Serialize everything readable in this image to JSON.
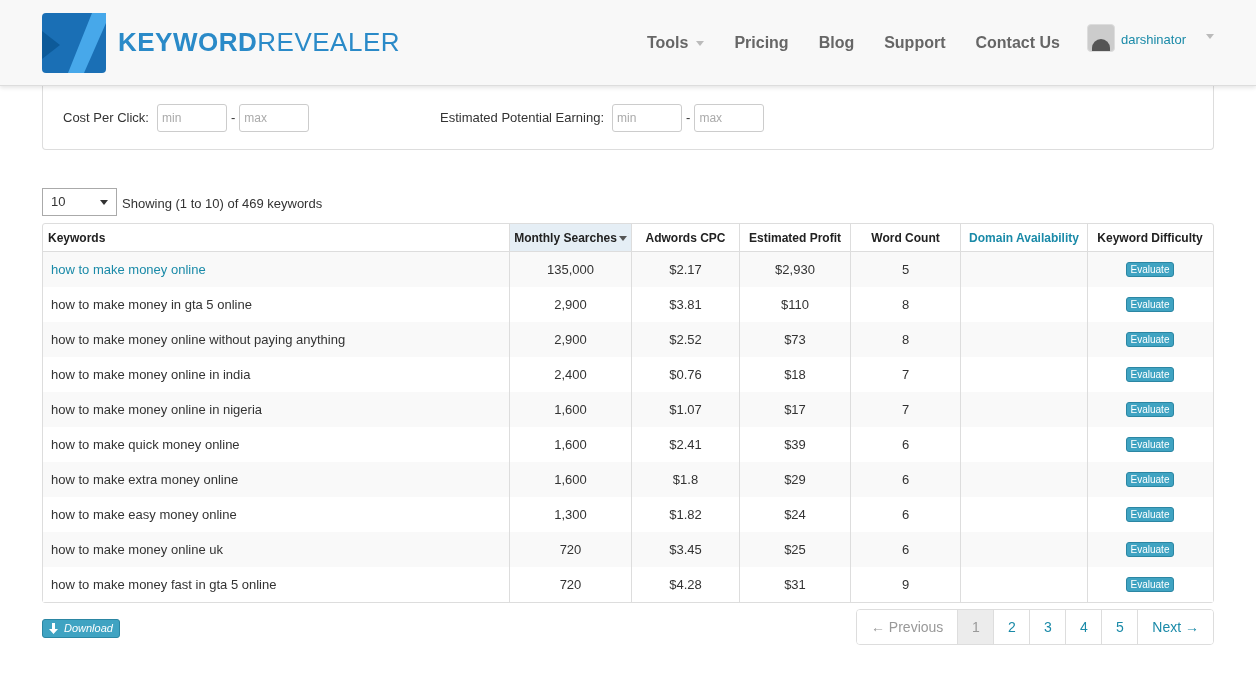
{
  "logo": {
    "text": "**KEYWORD**REVEALER"
  },
  "nav": [
    {
      "label": "Tools",
      "dropdown": true
    },
    {
      "label": "Pricing",
      "dropdown": false
    },
    {
      "label": "Blog",
      "dropdown": false
    },
    {
      "label": "Support",
      "dropdown": false
    },
    {
      "label": "Contact Us",
      "dropdown": false
    }
  ],
  "user": {
    "name": "darshinator"
  },
  "filters": [
    {
      "label": "Cost Per Click:",
      "min_placeholder": "min",
      "separator": "-",
      "max_placeholder": "max"
    },
    {
      "label": "Estimated Potential Earning:",
      "min_placeholder": "min",
      "separator": "-",
      "max_placeholder": "max"
    }
  ],
  "page_size": {
    "value": "10",
    "summary": "Showing (1 to 10) of 469 keywords"
  },
  "table": {
    "columns": [
      {
        "label": "Keywords",
        "kind": "plain",
        "selected": false
      },
      {
        "label": "Monthly Searches",
        "kind": "plain",
        "selected": true
      },
      {
        "label": "Adwords CPC",
        "kind": "plain",
        "selected": false
      },
      {
        "label": "Estimated Profit",
        "kind": "plain",
        "selected": false
      },
      {
        "label": "Word Count",
        "kind": "plain",
        "selected": false
      },
      {
        "label": "Domain Availability",
        "kind": "link",
        "selected": false
      },
      {
        "label": "Keyword Difficulty",
        "kind": "plain",
        "selected": false
      }
    ],
    "rows": [
      {
        "keyword": "how to make money online",
        "kind": "link",
        "searches": "135,000",
        "cpc": "$2.17",
        "profit": "$2,930",
        "words": "5",
        "action": "Evaluate"
      },
      {
        "keyword": "how to make money in gta 5 online",
        "kind": "plain",
        "searches": "2,900",
        "cpc": "$3.81",
        "profit": "$110",
        "words": "8",
        "action": "Evaluate"
      },
      {
        "keyword": "how to make money online without paying anything",
        "kind": "plain",
        "searches": "2,900",
        "cpc": "$2.52",
        "profit": "$73",
        "words": "8",
        "action": "Evaluate"
      },
      {
        "keyword": "how to make money online in india",
        "kind": "plain",
        "searches": "2,400",
        "cpc": "$0.76",
        "profit": "$18",
        "words": "7",
        "action": "Evaluate"
      },
      {
        "keyword": "how to make money online in nigeria",
        "kind": "plain",
        "searches": "1,600",
        "cpc": "$1.07",
        "profit": "$17",
        "words": "7",
        "action": "Evaluate"
      },
      {
        "keyword": "how to make quick money online",
        "kind": "plain",
        "searches": "1,600",
        "cpc": "$2.41",
        "profit": "$39",
        "words": "6",
        "action": "Evaluate"
      },
      {
        "keyword": "how to make extra money online",
        "kind": "plain",
        "searches": "1,600",
        "cpc": "$1.8",
        "profit": "$29",
        "words": "6",
        "action": "Evaluate"
      },
      {
        "keyword": "how to make easy money online",
        "kind": "plain",
        "searches": "1,300",
        "cpc": "$1.82",
        "profit": "$24",
        "words": "6",
        "action": "Evaluate"
      },
      {
        "keyword": "how to make money online uk",
        "kind": "plain",
        "searches": "720",
        "cpc": "$3.45",
        "profit": "$25",
        "words": "6",
        "action": "Evaluate"
      },
      {
        "keyword": "how to make money fast in gta 5 online",
        "kind": "plain",
        "searches": "720",
        "cpc": "$4.28",
        "profit": "$31",
        "words": "9",
        "action": "Evaluate"
      }
    ]
  },
  "download": {
    "label": "Download"
  },
  "pagination": [
    {
      "label": "← Previous",
      "selected": false,
      "disabled": true
    },
    {
      "label": "1",
      "selected": true
    },
    {
      "label": "2",
      "selected": false
    },
    {
      "label": "3",
      "selected": false
    },
    {
      "label": "4",
      "selected": false
    },
    {
      "label": "5",
      "selected": false
    },
    {
      "label": "Next →",
      "selected": false
    }
  ]
}
